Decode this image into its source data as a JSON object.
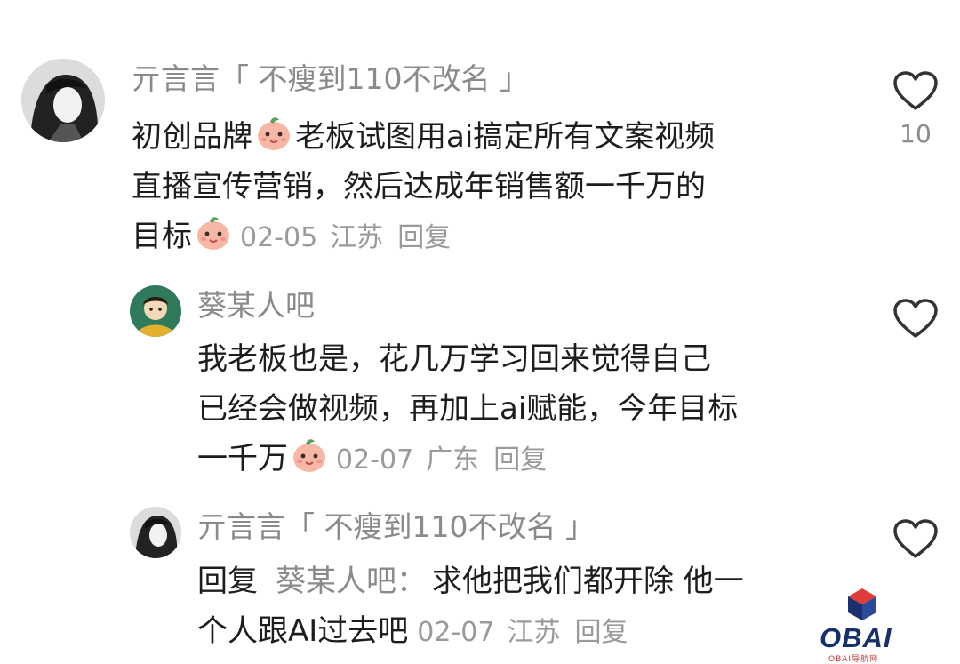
{
  "comments": [
    {
      "username": "亓言言「 不瘦到110不改名 」",
      "lines": [
        "初创品牌",
        "老板试图用ai搞定所有文案视频",
        "直播宣传营销，然后达成年销售额一千万的",
        "目标"
      ],
      "date": "02-05",
      "location": "江苏",
      "reply_label": "回复",
      "like_count": "10",
      "avatar_icon": "user-avatar-bw",
      "emoji_icon": "peach-face-emoji"
    },
    {
      "username": "葵某人吧",
      "lines": [
        "我老板也是，花几万学习回来觉得自己",
        "已经会做视频，再加上ai赋能，今年目标",
        "一千万"
      ],
      "date": "02-07",
      "location": "广东",
      "reply_label": "回复",
      "like_count": "",
      "avatar_icon": "cartoon-avatar-green"
    },
    {
      "username": "亓言言「 不瘦到110不改名 」",
      "reply_prefix": "回复",
      "reply_to": "葵某人吧：",
      "lines": [
        "求他把我们都开除 他一",
        "个人跟AI过去吧"
      ],
      "date": "02-07",
      "location": "江苏",
      "reply_label": "回复",
      "like_count": "",
      "avatar_icon": "user-avatar-bw"
    }
  ],
  "watermark": {
    "text": "OBAI",
    "sub": "OBAI导航网"
  },
  "colors": {
    "username": "#8a8a8a",
    "text": "#1d1d1d",
    "meta": "#9a9a9a",
    "heart": "#333333"
  },
  "icons": [
    "heart-outline-icon",
    "peach-face-emoji"
  ]
}
